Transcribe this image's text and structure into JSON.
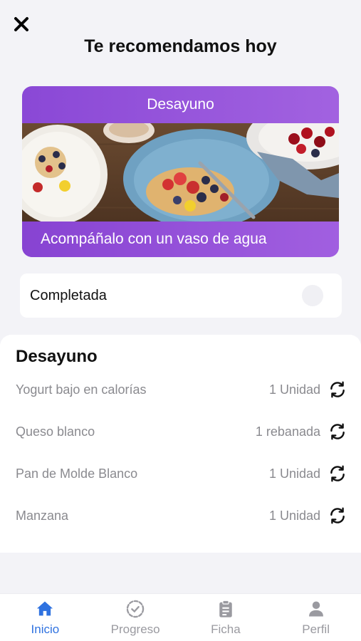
{
  "header": {
    "close_icon": "close-icon",
    "title": "Te recomendamos hoy"
  },
  "meal_card": {
    "meal_name": "Desayuno",
    "tip": "Acompáñalo con un vaso de agua",
    "gradient_start": "#8a48d6",
    "gradient_end": "#a262e0"
  },
  "completed": {
    "label": "Completada",
    "checked": false
  },
  "meal_detail": {
    "title": "Desayuno",
    "items": [
      {
        "name": "Yogurt bajo en calorías",
        "quantity": "1 Unidad",
        "icon": "swap-icon"
      },
      {
        "name": "Queso blanco",
        "quantity": "1 rebanada",
        "icon": "swap-icon"
      },
      {
        "name": "Pan de Molde Blanco",
        "quantity": "1 Unidad",
        "icon": "swap-icon"
      },
      {
        "name": "Manzana",
        "quantity": "1 Unidad",
        "icon": "swap-icon"
      }
    ]
  },
  "bottom_nav": {
    "items": [
      {
        "label": "Inicio",
        "icon": "home-icon",
        "active": true
      },
      {
        "label": "Progreso",
        "icon": "progress-icon",
        "active": false
      },
      {
        "label": "Ficha",
        "icon": "clipboard-icon",
        "active": false
      },
      {
        "label": "Perfil",
        "icon": "person-icon",
        "active": false
      }
    ],
    "active_color": "#2f72e0",
    "inactive_color": "#9a9aa0"
  }
}
